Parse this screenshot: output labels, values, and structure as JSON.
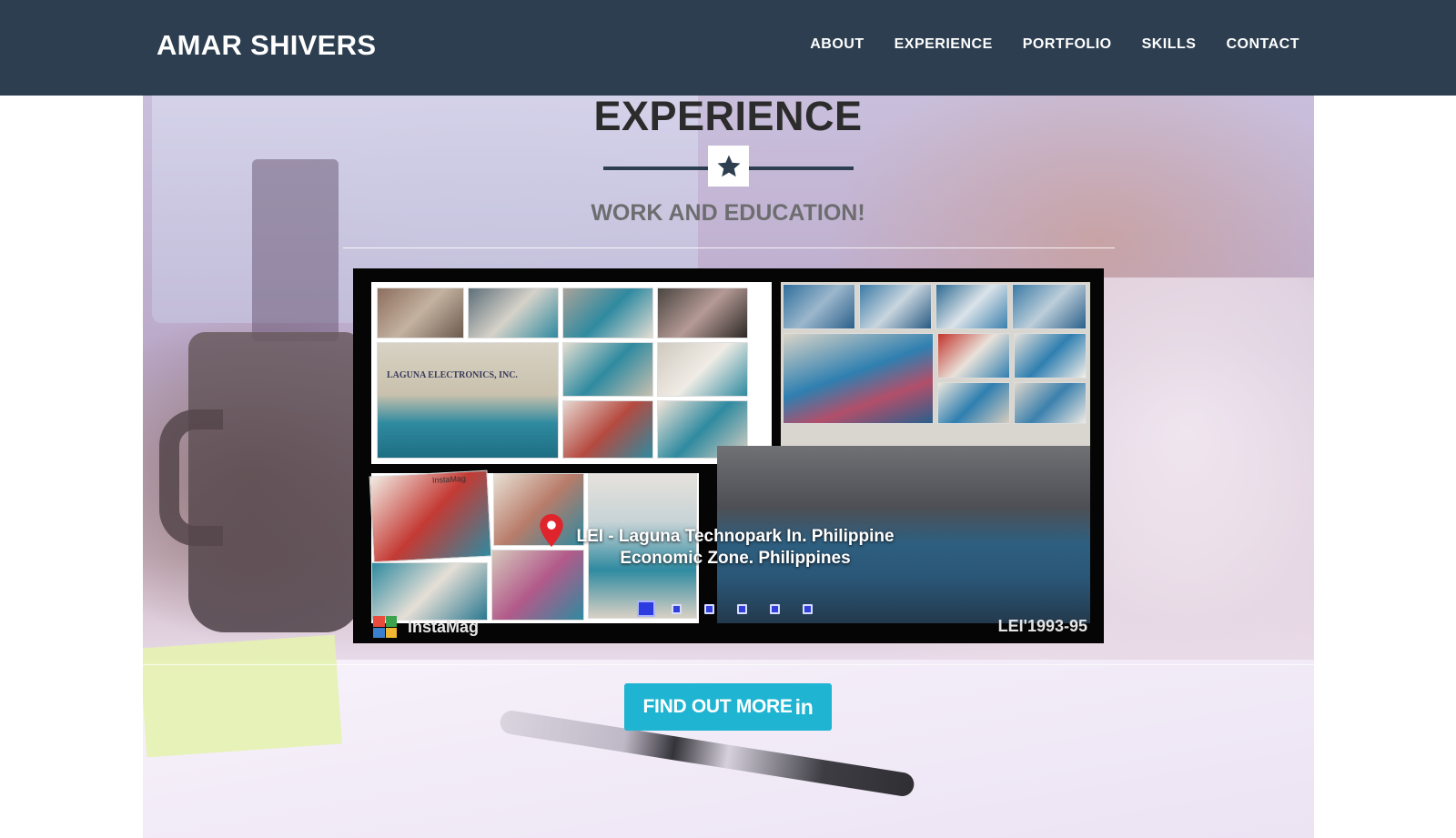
{
  "navbar": {
    "brand": "AMAR SHIVERS",
    "links": [
      "ABOUT",
      "EXPERIENCE",
      "PORTFOLIO",
      "SKILLS",
      "CONTACT"
    ]
  },
  "section": {
    "title": "EXPERIENCE",
    "subtitle": "WORK AND EDUCATION!",
    "divider_icon": "star-icon"
  },
  "carousel": {
    "caption_line1": "LEI - Laguna Technopark In. Philippine",
    "caption_line2": "Economic Zone. Philippines",
    "location_icon": "map-pin-icon",
    "collage_sign": "LAGUNA ELECTRONICS, INC.",
    "collage_app": "InstaMag",
    "collage_app_small": "InstaMag",
    "stamp": "LEI'1993-95",
    "slide_count": 6,
    "active_slide": 1
  },
  "cta": {
    "label": "FIND OUT MORE",
    "icon_text": "in",
    "icon": "linkedin-icon"
  },
  "colors": {
    "navbar": "#2c3e50",
    "button": "#1fb4d2",
    "active_dot": "#2b3be0",
    "title": "#2c2c2c",
    "subtitle": "#6d6d70"
  }
}
